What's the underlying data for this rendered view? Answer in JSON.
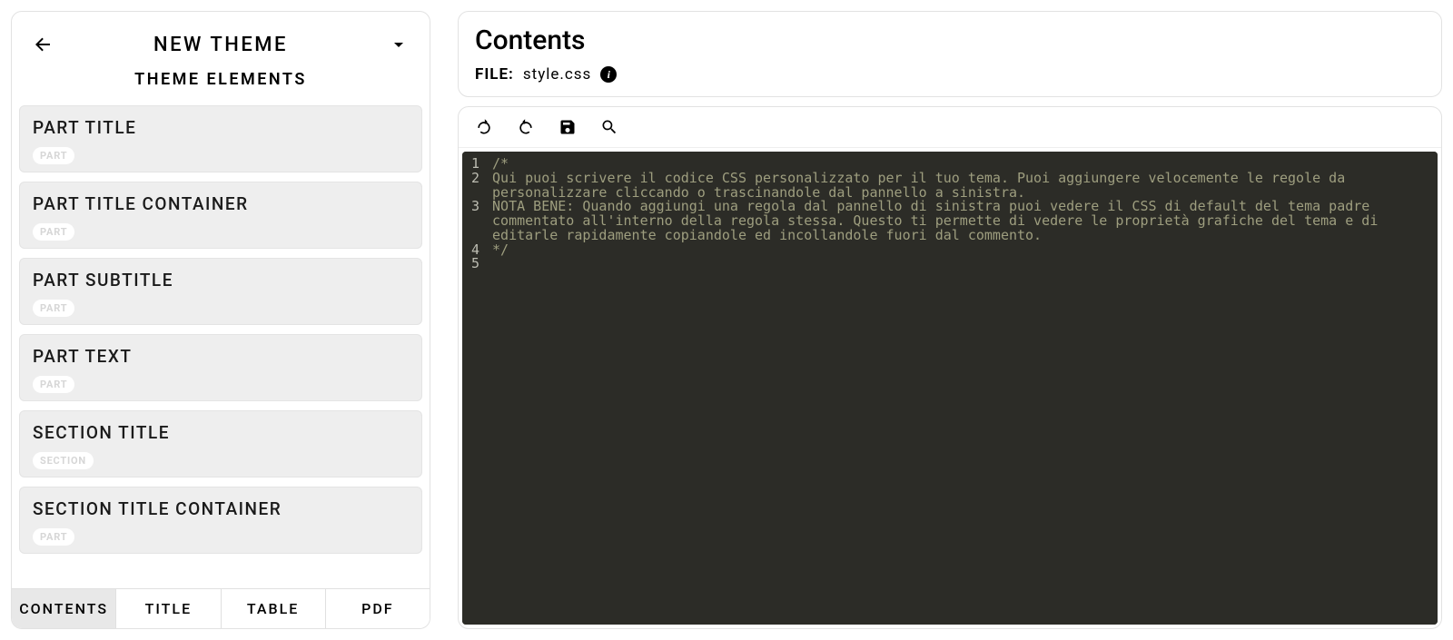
{
  "sidebar": {
    "header_title": "NEW THEME",
    "subtitle": "THEME ELEMENTS",
    "elements": [
      {
        "title": "PART TITLE",
        "badge": "PART"
      },
      {
        "title": "PART TITLE CONTAINER",
        "badge": "PART"
      },
      {
        "title": "PART SUBTITLE",
        "badge": "PART"
      },
      {
        "title": "PART TEXT",
        "badge": "PART"
      },
      {
        "title": "SECTION TITLE",
        "badge": "SECTION"
      },
      {
        "title": "SECTION TITLE CONTAINER",
        "badge": "PART"
      }
    ],
    "tabs": [
      "CONTENTS",
      "TITLE",
      "TABLE",
      "PDF"
    ],
    "active_tab": 0
  },
  "main": {
    "header_title": "Contents",
    "file_label": "FILE:",
    "file_name": "style.css",
    "info_glyph": "i",
    "code_lines": [
      "/*",
      "Qui puoi scrivere il codice CSS personalizzato per il tuo tema. Puoi aggiungere velocemente le regole da personalizzare cliccando o trascinandole dal pannello a sinistra.",
      "NOTA BENE: Quando aggiungi una regola dal pannello di sinistra puoi vedere il CSS di default del tema padre commentato all'interno della regola stessa. Questo ti permette di vedere le proprietà grafiche del tema e di editarle rapidamente copiandole ed incollandole fuori dal commento.",
      "*/",
      ""
    ]
  }
}
